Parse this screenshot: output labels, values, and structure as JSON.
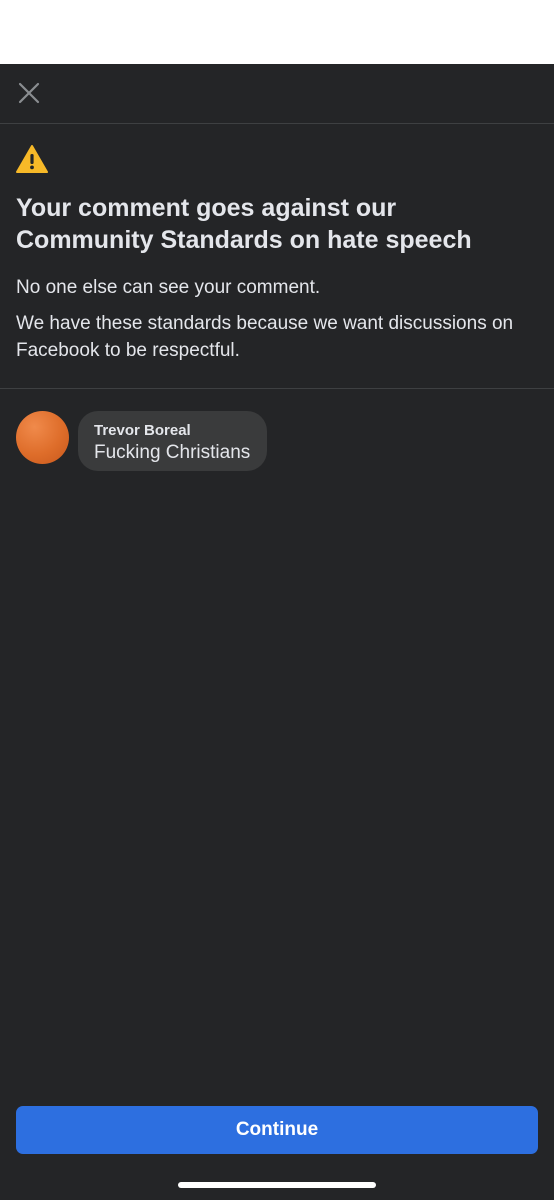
{
  "dialog": {
    "title": "Your comment goes against our Community Standards on hate speech",
    "message_1": "No one else can see your comment.",
    "message_2": "We have these standards because we want discussions on Facebook to be respectful."
  },
  "comment": {
    "author": "Trevor Boreal",
    "text": "Fucking Christians"
  },
  "actions": {
    "continue_label": "Continue"
  },
  "icons": {
    "close": "close-icon",
    "warning": "warning-icon"
  },
  "colors": {
    "background": "#242527",
    "text": "#e4e6eb",
    "bubble": "#3a3b3c",
    "primary_button": "#2d6fe0",
    "warning": "#f7b928",
    "avatar": "#de6d2a"
  }
}
